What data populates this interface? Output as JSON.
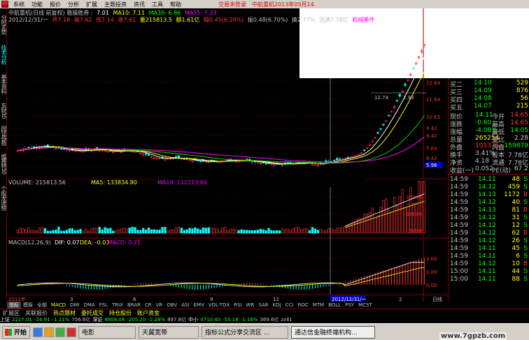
{
  "menu": {
    "items": [
      "系统",
      "功能",
      "报价",
      "分析",
      "扩展",
      "主题投资",
      "资讯",
      "工具",
      "帮助"
    ],
    "title_status": "交易未登录",
    "title_stock": "中航重机2013年05月14"
  },
  "side_tabs": [
    "分时走势",
    "技术分析",
    "基本资料",
    "东财10",
    "园证指数",
    "维赛特10",
    "个股龙虎榜"
  ],
  "info": {
    "row1": [
      "中航重机(日线 前复权) 稳操胜券 :",
      "7.01",
      "MA10: 7.11",
      "MA30: 6.86",
      "MA55: 7.23"
    ],
    "row2": [
      "2012/12/31/一",
      "开7.18",
      "高7.62",
      "低7.14",
      "收7.61",
      "量215813.5",
      "额1.61亿",
      "幅0.45(6.28%)",
      "振0.48(6.70%)",
      "换2.77%",
      "流通7.78亿",
      "机械基件"
    ]
  },
  "price_axis": [
    "12.64",
    "11.84",
    "10.63",
    "9.42",
    "8.42",
    "7.64",
    "6.42",
    "5.96"
  ],
  "price_annotations": [
    "12.74",
    "2.93",
    "5.96"
  ],
  "volume_info": [
    "VOLUME: 215813.56",
    "MA5: 133834.80",
    "MA10: 112213.60"
  ],
  "volume_axis": [
    "15000",
    "10000",
    "5000"
  ],
  "macd_info": [
    "MACD(12,26,9)",
    "DIF: 0.07",
    "DEA: -0.03",
    "MACD: 0.21"
  ],
  "macd_axis": [
    "2.00",
    "1.00",
    "0.00"
  ],
  "x_axis": [
    "2012年",
    "3",
    "6",
    "9",
    "12",
    "2012/12/31/一",
    "2",
    "日线"
  ],
  "bottom_tabs": [
    "指标",
    "模板",
    "全部",
    "MACD",
    "DMI",
    "DMA",
    "FSL",
    "TRIX",
    "BRAR",
    "CR",
    "VR",
    "OBV",
    "ASI",
    "EMV",
    "VOL-TDX",
    "RSI",
    "WR",
    "SAR",
    "KDJ",
    "CCI",
    "ROC",
    "MTM",
    "BOLL",
    "PSY",
    "MCST"
  ],
  "bottom_tabs2": [
    "扩展区",
    "关联报价",
    "热点题材",
    "委托成交",
    "持仓股份",
    "账户资金"
  ],
  "quote": {
    "buy_rows": [
      {
        "label": "买二",
        "price": "14.10",
        "vol": "529"
      },
      {
        "label": "买三",
        "price": "14.09",
        "vol": "876"
      },
      {
        "label": "买四",
        "price": "14.08",
        "vol": "56"
      },
      {
        "label": "买五",
        "price": "14.07",
        "vol": "215"
      }
    ],
    "stats": [
      {
        "l1": "现价",
        "v1": "14.11",
        "l2": "今开",
        "v2": "14.65"
      },
      {
        "l1": "涨跌",
        "v1": "-0.60",
        "l2": "最高",
        "v2": "14.65"
      },
      {
        "l1": "涨幅",
        "v1": "-4.08%",
        "l2": "最低",
        "v2": "14.05"
      },
      {
        "l1": "总量",
        "v1": "265254",
        "l2": "量比",
        "v2": "2.28"
      },
      {
        "l1": "外盘",
        "v1": "105375",
        "l2": "内盘",
        "v2": "159879"
      },
      {
        "l1": "换手",
        "v1": "3.41%",
        "l2": "股本",
        "v2": "7.78亿"
      },
      {
        "l1": "净资",
        "v1": "4.18",
        "l2": "流通",
        "v2": "7.78亿"
      },
      {
        "l1": "收益(一)",
        "v1": "0.052",
        "l2": "PE(动)",
        "v2": "67.2"
      }
    ],
    "ticks": [
      {
        "t": "14:59",
        "p": "14.11",
        "v": "48",
        "s": "S"
      },
      {
        "t": "14:59",
        "p": "14.12",
        "v": "459",
        "s": "S"
      },
      {
        "t": "14:59",
        "p": "14.13",
        "v": "1172",
        "s": "B"
      },
      {
        "t": "14:59",
        "p": "14.12",
        "v": "40",
        "s": "S"
      },
      {
        "t": "14:59",
        "p": "14.13",
        "v": "81",
        "s": "B"
      },
      {
        "t": "14:59",
        "p": "14.12",
        "v": "31",
        "s": "S"
      },
      {
        "t": "14:59",
        "p": "14.12",
        "v": "12",
        "s": "S"
      },
      {
        "t": "14:59",
        "p": "14.12",
        "v": "62",
        "s": "B"
      },
      {
        "t": "14:59",
        "p": "14.12",
        "v": "26",
        "s": "S"
      },
      {
        "t": "14:59",
        "p": "14.11",
        "v": "45",
        "s": "S"
      },
      {
        "t": "14:59",
        "p": "14.11",
        "v": "6",
        "s": "S"
      },
      {
        "t": "14:59",
        "p": "14.12",
        "v": "10",
        "s": "B"
      },
      {
        "t": "15:00",
        "p": "14.11",
        "v": "44",
        "s": "S"
      },
      {
        "t": "15:00",
        "p": "14.11",
        "v": "88",
        "s": "S"
      }
    ]
  },
  "index_bar": [
    {
      "t": "上证",
      "c": "#ffffff"
    },
    {
      "t": "2217.01",
      "c": "#00ff00"
    },
    {
      "t": "-24.91",
      "c": "#00ff00"
    },
    {
      "t": "-1.11%",
      "c": "#00ff00"
    },
    {
      "t": "756.6亿",
      "c": "#c0c0c0"
    },
    {
      "t": "深证",
      "c": "#ffffff"
    },
    {
      "t": "8808.08",
      "c": "#00ff00"
    },
    {
      "t": "-205.20",
      "c": "#00ff00"
    },
    {
      "t": "-2.28%",
      "c": "#00ff00"
    },
    {
      "t": "897.8亿",
      "c": "#c0c0c0"
    },
    {
      "t": "中小",
      "c": "#ffffff"
    },
    {
      "t": "4710.40",
      "c": "#00ff00"
    },
    {
      "t": "-55.18",
      "c": "#00ff00"
    },
    {
      "t": "-1.16%",
      "c": "#00ff00"
    },
    {
      "t": "369.6亿",
      "c": "#c0c0c0"
    },
    {
      "t": "zz41",
      "c": "#c0c0c0"
    }
  ],
  "taskbar": {
    "start": "开始",
    "tasks": [
      "电影",
      "天翼宽带",
      "指标公式分享交流区 ...",
      "通达信金融终端机构..."
    ],
    "watermark": "www.7gpzb.com"
  },
  "colors": {
    "up": "#ff3232",
    "down": "#00ffff",
    "ma_white": "#ffffff",
    "ma_yellow": "#ffff00",
    "ma_green": "#00cc00",
    "ma_magenta": "#ff00ff",
    "frame": "#800000"
  }
}
